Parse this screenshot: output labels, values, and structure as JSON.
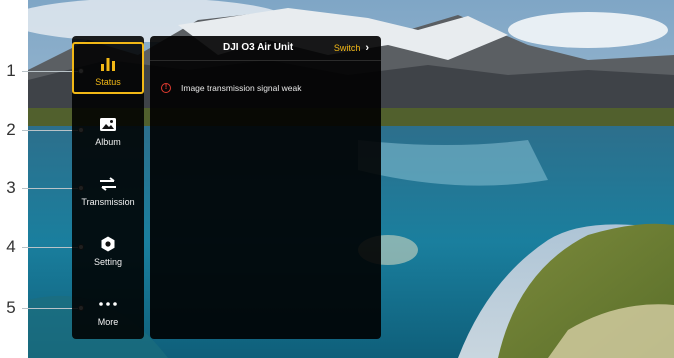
{
  "callouts": [
    "1",
    "2",
    "3",
    "4",
    "5"
  ],
  "menu": {
    "items": [
      {
        "label": "Status",
        "icon": "status-bars-icon",
        "active": true
      },
      {
        "label": "Album",
        "icon": "album-image-icon",
        "active": false
      },
      {
        "label": "Transmission",
        "icon": "transmission-arrows-icon",
        "active": false
      },
      {
        "label": "Setting",
        "icon": "settings-hexagon-icon",
        "active": false
      },
      {
        "label": "More",
        "icon": "more-dots-icon",
        "active": false
      }
    ]
  },
  "panel": {
    "title": "DJI O3 Air Unit",
    "switch_label": "Switch",
    "alert": {
      "icon": "warning-circle-icon",
      "text": "Image transmission signal weak"
    }
  },
  "colors": {
    "accent": "#f2b816",
    "alert": "#e23b30",
    "panel_bg": "#111111"
  }
}
